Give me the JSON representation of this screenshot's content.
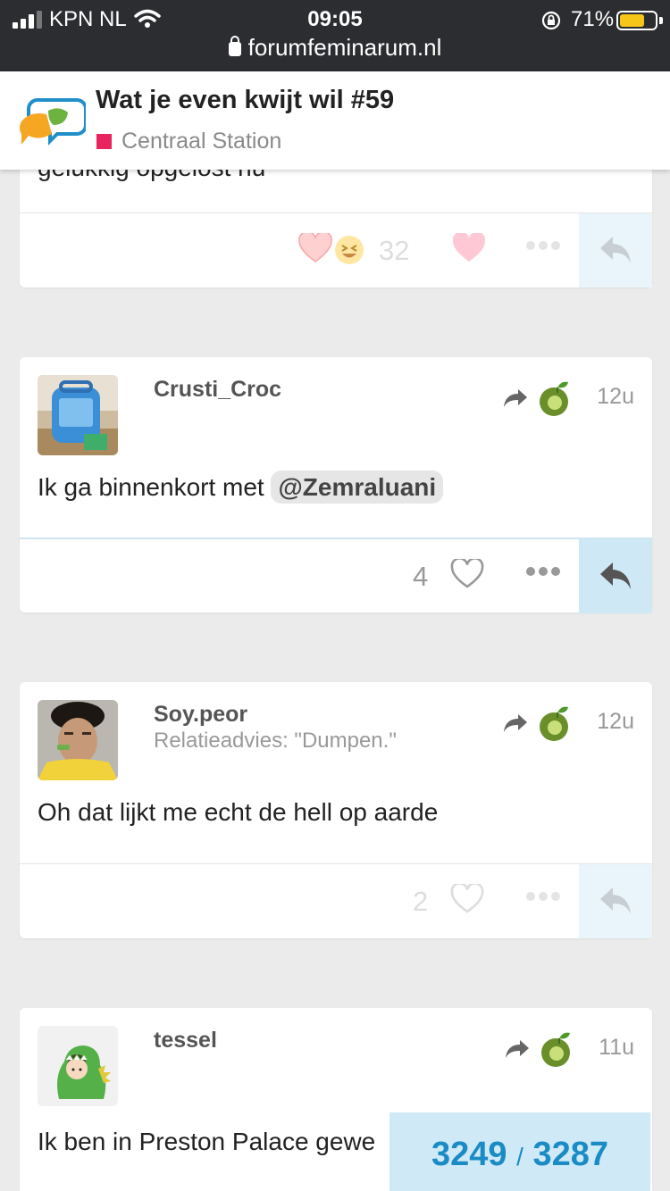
{
  "status_bar": {
    "carrier": "KPN NL",
    "time": "09:05",
    "battery_percent": "71%",
    "battery_level": 0.71,
    "url": "forumfeminarum.nl"
  },
  "header": {
    "title": "Wat je even kwijt wil #59",
    "category": "Centraal Station",
    "category_color": "#e8245e"
  },
  "posts": [
    {
      "partial_text": "gelukkig opgelost nu",
      "reactions_count": "32",
      "reply_icon": "reply-arrow-icon"
    },
    {
      "username": "Crusti_Croc",
      "time": "12u",
      "body_text": "Ik ga binnenkort met ",
      "mention": "@Zemraluani",
      "likes": "4"
    },
    {
      "username": "Soy.peor",
      "user_title": "Relatieadvies: \"Dumpen.\"",
      "time": "12u",
      "body_text": "Oh dat lijkt me echt de hell op aarde",
      "likes": "2"
    },
    {
      "username": "tessel",
      "time": "11u",
      "body_text": "Ik ben in Preston Palace gewe"
    }
  ],
  "progress": {
    "current": "3249",
    "separator": "/",
    "total": "3287"
  }
}
